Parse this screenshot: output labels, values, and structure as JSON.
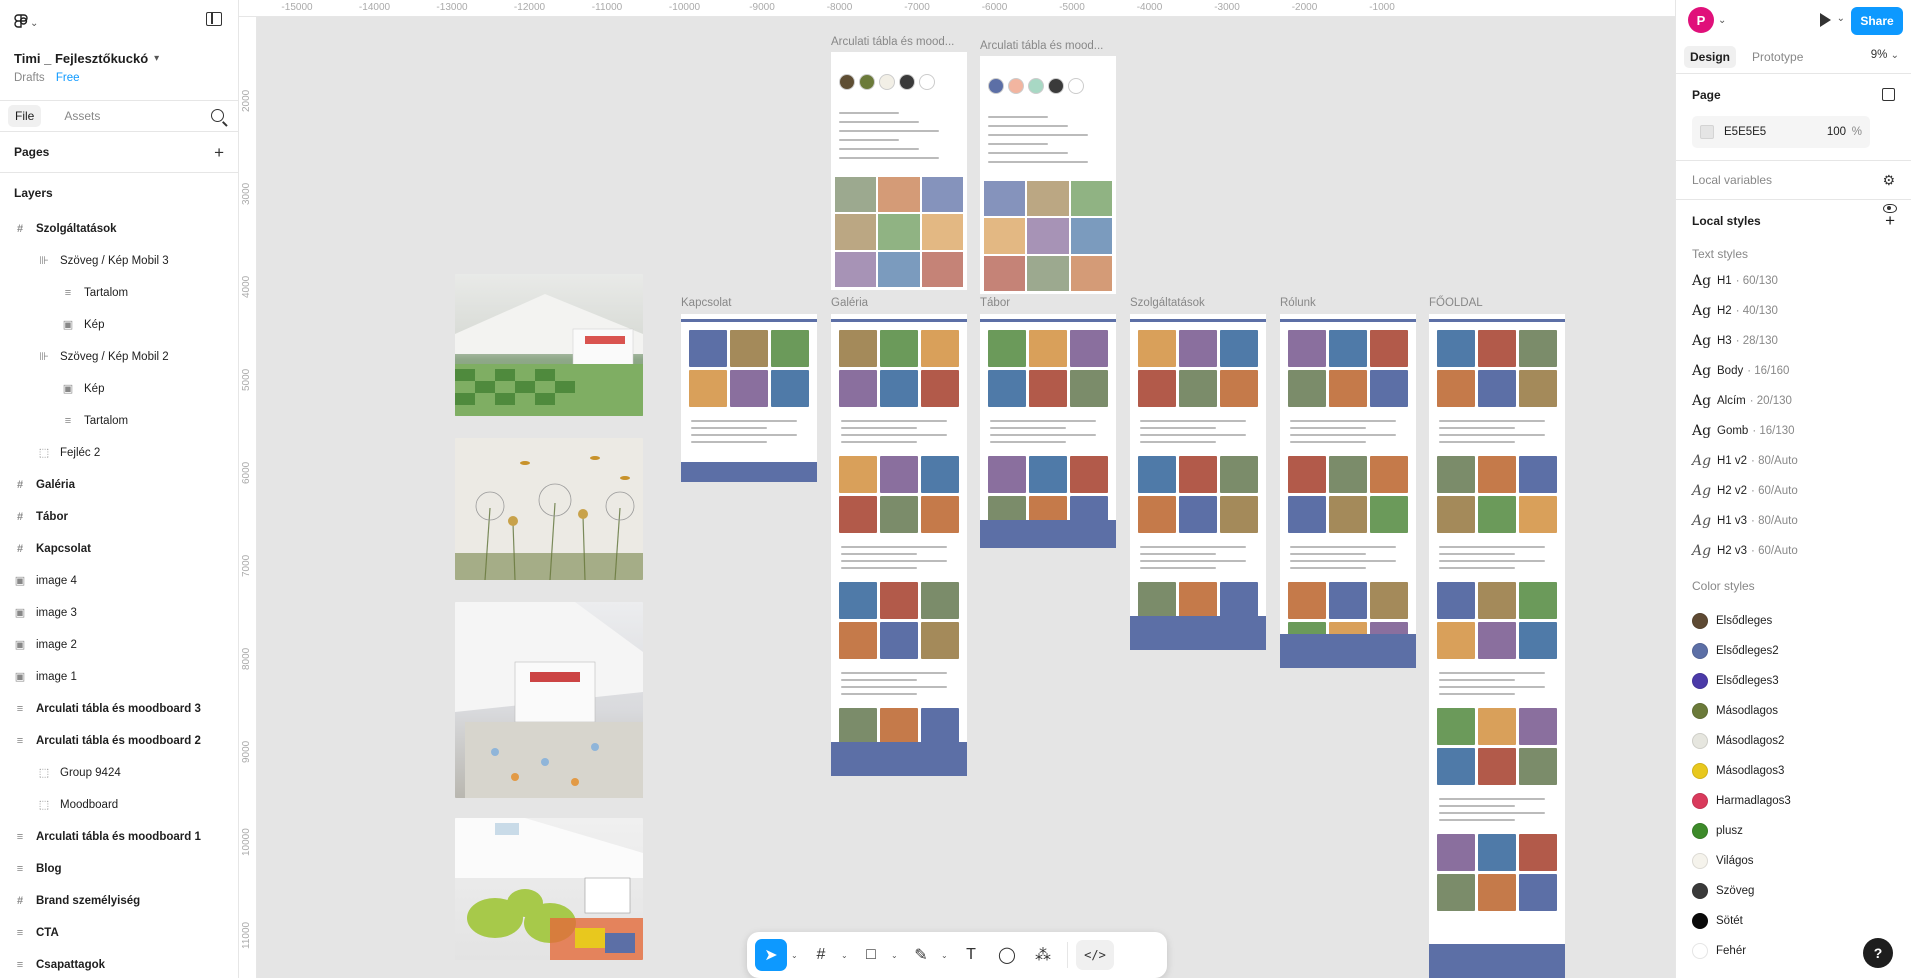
{
  "app": {
    "project_name": "Timi _ Fejlesztőkuckó",
    "project_location": "Drafts",
    "plan": "Free"
  },
  "left_panel": {
    "tabs": [
      "File",
      "Assets"
    ],
    "pages_title": "Pages",
    "layers_title": "Layers",
    "layers": [
      {
        "label": "Szolgáltatások",
        "level": 0,
        "icon": "frame-icon",
        "glyph": "#",
        "bold": true
      },
      {
        "label": "Szöveg / Kép Mobil 3",
        "level": 1,
        "icon": "autolayout-icon",
        "glyph": "⊪",
        "bold": false
      },
      {
        "label": "Tartalom",
        "level": 2,
        "icon": "text-frame-icon",
        "glyph": "≡",
        "bold": false
      },
      {
        "label": "Kép",
        "level": 2,
        "icon": "image-icon",
        "glyph": "▣",
        "bold": false
      },
      {
        "label": "Szöveg / Kép Mobil 2",
        "level": 1,
        "icon": "autolayout-icon",
        "glyph": "⊪",
        "bold": false
      },
      {
        "label": "Kép",
        "level": 2,
        "icon": "image-icon",
        "glyph": "▣",
        "bold": false
      },
      {
        "label": "Tartalom",
        "level": 2,
        "icon": "text-frame-icon",
        "glyph": "≡",
        "bold": false
      },
      {
        "label": "Fejléc 2",
        "level": 1,
        "icon": "component-icon",
        "glyph": "⬚",
        "bold": false
      },
      {
        "label": "Galéria",
        "level": 0,
        "icon": "frame-icon",
        "glyph": "#",
        "bold": true
      },
      {
        "label": "Tábor",
        "level": 0,
        "icon": "frame-icon",
        "glyph": "#",
        "bold": true
      },
      {
        "label": "Kapcsolat",
        "level": 0,
        "icon": "frame-icon",
        "glyph": "#",
        "bold": true
      },
      {
        "label": "image 4",
        "level": 0,
        "icon": "image-icon",
        "glyph": "▣",
        "bold": false
      },
      {
        "label": "image 3",
        "level": 0,
        "icon": "image-icon",
        "glyph": "▣",
        "bold": false
      },
      {
        "label": "image 2",
        "level": 0,
        "icon": "image-icon",
        "glyph": "▣",
        "bold": false
      },
      {
        "label": "image 1",
        "level": 0,
        "icon": "image-icon",
        "glyph": "▣",
        "bold": false
      },
      {
        "label": "Arculati tábla és moodboard 3",
        "level": 0,
        "icon": "text-frame-icon",
        "glyph": "≡",
        "bold": true
      },
      {
        "label": "Arculati tábla és moodboard 2",
        "level": 0,
        "icon": "text-frame-icon",
        "glyph": "≡",
        "bold": true
      },
      {
        "label": "Group 9424",
        "level": 1,
        "icon": "group-icon",
        "glyph": "⬚",
        "bold": false
      },
      {
        "label": "Moodboard",
        "level": 1,
        "icon": "group-icon",
        "glyph": "⬚",
        "bold": false
      },
      {
        "label": "Arculati tábla és moodboard 1",
        "level": 0,
        "icon": "text-frame-icon",
        "glyph": "≡",
        "bold": true
      },
      {
        "label": "Blog",
        "level": 0,
        "icon": "text-frame-icon",
        "glyph": "≡",
        "bold": true
      },
      {
        "label": "Brand személyiség",
        "level": 0,
        "icon": "frame-icon",
        "glyph": "#",
        "bold": true
      },
      {
        "label": "CTA",
        "level": 0,
        "icon": "text-frame-icon",
        "glyph": "≡",
        "bold": true
      },
      {
        "label": "Csapattagok",
        "level": 0,
        "icon": "text-frame-icon",
        "glyph": "≡",
        "bold": true
      }
    ]
  },
  "rulers": {
    "top": [
      "-15000",
      "-14000",
      "-13000",
      "-12000",
      "-11000",
      "-10000",
      "-9000",
      "-8000",
      "-7000",
      "-6000",
      "-5000",
      "-4000",
      "-3000",
      "-2000",
      "-1000"
    ],
    "left": [
      "2000",
      "3000",
      "4000",
      "5000",
      "6000",
      "7000",
      "8000",
      "9000",
      "10000",
      "11000"
    ]
  },
  "canvas": {
    "frames": [
      {
        "label": "Arculati tábla és mood...",
        "kind": "moodboard"
      },
      {
        "label": "Arculati tábla és mood...",
        "kind": "moodboard"
      },
      {
        "label": "Kapcsolat",
        "kind": "page"
      },
      {
        "label": "Galéria",
        "kind": "page"
      },
      {
        "label": "Tábor",
        "kind": "page"
      },
      {
        "label": "Szolgáltatások",
        "kind": "page"
      },
      {
        "label": "Rólunk",
        "kind": "page"
      },
      {
        "label": "FŐOLDAL",
        "kind": "page"
      }
    ],
    "moodboard_palettes": [
      [
        "#5e4e33",
        "#6b7a3a",
        "#f2efe6",
        "#3a3a3a",
        "#ffffff"
      ],
      [
        "#5c6fa6",
        "#f2b5a0",
        "#a8d8c4",
        "#3a3a3a",
        "#ffffff"
      ]
    ]
  },
  "toolbar": {
    "tools": [
      {
        "name": "move-tool",
        "glyph": "➤",
        "active": true
      },
      {
        "name": "frame-tool",
        "glyph": "#",
        "active": false
      },
      {
        "name": "rectangle-tool",
        "glyph": "□",
        "active": false
      },
      {
        "name": "pen-tool",
        "glyph": "✎",
        "active": false
      },
      {
        "name": "text-tool",
        "glyph": "T",
        "active": false
      },
      {
        "name": "comment-tool",
        "glyph": "◯",
        "active": false
      },
      {
        "name": "actions-tool",
        "glyph": "⁂",
        "active": false
      }
    ],
    "dev_mode_label": "</>"
  },
  "right_panel": {
    "avatar_initial": "P",
    "share_label": "Share",
    "tabs": [
      "Design",
      "Prototype"
    ],
    "zoom": "9%",
    "page_section_title": "Page",
    "page_color": "E5E5E5",
    "page_opacity": "100",
    "page_opacity_unit": "%",
    "local_variables": "Local variables",
    "local_styles": "Local styles",
    "text_styles_title": "Text styles",
    "text_styles": [
      {
        "name": "H1",
        "meta": "· 60/130",
        "glyph": "Ag"
      },
      {
        "name": "H2",
        "meta": "· 40/130",
        "glyph": "Ag"
      },
      {
        "name": "H3",
        "meta": "· 28/130",
        "glyph": "Ag"
      },
      {
        "name": "Body",
        "meta": "· 16/160",
        "glyph": "Ag"
      },
      {
        "name": "Alcím",
        "meta": "· 20/130",
        "glyph": "Ag"
      },
      {
        "name": "Gomb",
        "meta": "· 16/130",
        "glyph": "Ag"
      },
      {
        "name": "H1 v2",
        "meta": "· 80/Auto",
        "glyph": "Ag"
      },
      {
        "name": "H2 v2",
        "meta": "· 60/Auto",
        "glyph": "Ag"
      },
      {
        "name": "H1 v3",
        "meta": "· 80/Auto",
        "glyph": "Ag"
      },
      {
        "name": "H2 v3",
        "meta": "· 60/Auto",
        "glyph": "Ag"
      }
    ],
    "color_styles_title": "Color styles",
    "color_styles": [
      {
        "name": "Elsődleges",
        "color": "#5e4a33"
      },
      {
        "name": "Elsődleges2",
        "color": "#5c6fa6"
      },
      {
        "name": "Elsődleges3",
        "color": "#4b3aa8"
      },
      {
        "name": "Másodlagos",
        "color": "#6b7a3a"
      },
      {
        "name": "Másodlagos2",
        "color": "#e6e6df"
      },
      {
        "name": "Másodlagos3",
        "color": "#e8c81e"
      },
      {
        "name": "Harmadlagos3",
        "color": "#d93a5c"
      },
      {
        "name": "plusz",
        "color": "#3d8a2a"
      },
      {
        "name": "Világos",
        "color": "#f5f3ec"
      },
      {
        "name": "Szöveg",
        "color": "#3a3a3a"
      },
      {
        "name": "Sötét",
        "color": "#0a0a0a"
      },
      {
        "name": "Fehér",
        "color": "#ffffff"
      }
    ],
    "help_label": "?"
  }
}
